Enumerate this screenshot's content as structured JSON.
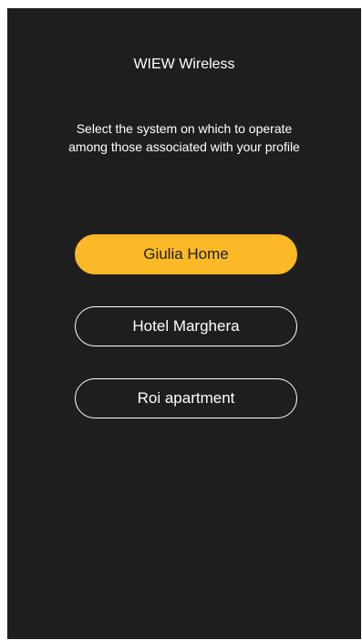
{
  "header": {
    "title": "WIEW Wireless"
  },
  "instructions": {
    "line1": "Select the system on which to operate",
    "line2": "among those associated with your profile"
  },
  "systems": [
    {
      "label": "Giulia Home",
      "selected": true
    },
    {
      "label": "Hotel Marghera",
      "selected": false
    },
    {
      "label": "Roi apartment",
      "selected": false
    }
  ],
  "colors": {
    "background": "#1e1e1e",
    "accent": "#fbb827",
    "text": "#ffffff"
  }
}
